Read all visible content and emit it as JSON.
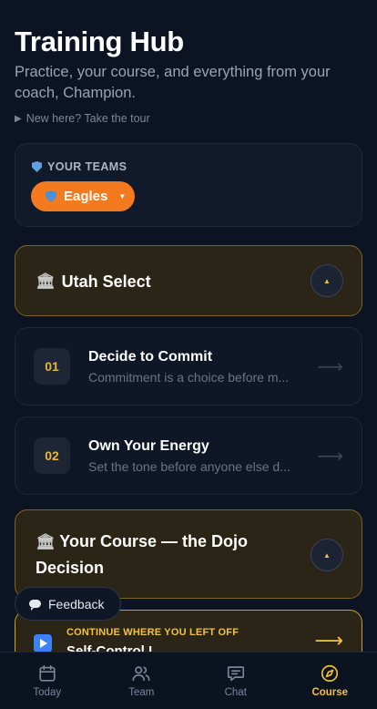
{
  "header": {
    "title": "Training Hub",
    "subtitle": "Practice, your course, and everything from your coach, Champion.",
    "tour_link": "New here? Take the tour"
  },
  "teams": {
    "label": "YOUR TEAMS",
    "selected_team": "Eagles"
  },
  "sections": [
    {
      "title": "Utah Select",
      "lessons": [
        {
          "number": "01",
          "title": "Decide to Commit",
          "subtitle": "Commitment is a choice before m..."
        },
        {
          "number": "02",
          "title": "Own Your Energy",
          "subtitle": "Set the tone before anyone else d..."
        }
      ]
    },
    {
      "title": "Your Course — the Dojo Decision"
    }
  ],
  "continue_card": {
    "label": "CONTINUE WHERE YOU LEFT OFF",
    "lesson": "Self-Control I"
  },
  "feedback_button": "Feedback",
  "tabbar": {
    "tabs": [
      {
        "label": "Today",
        "icon": "calendar-icon"
      },
      {
        "label": "Team",
        "icon": "people-icon"
      },
      {
        "label": "Chat",
        "icon": "chat-icon"
      },
      {
        "label": "Course",
        "icon": "compass-icon"
      }
    ],
    "active": "Course"
  },
  "colors": {
    "accent": "#f4c23a",
    "team_pill": "#f47a20",
    "background": "#0c1424"
  }
}
